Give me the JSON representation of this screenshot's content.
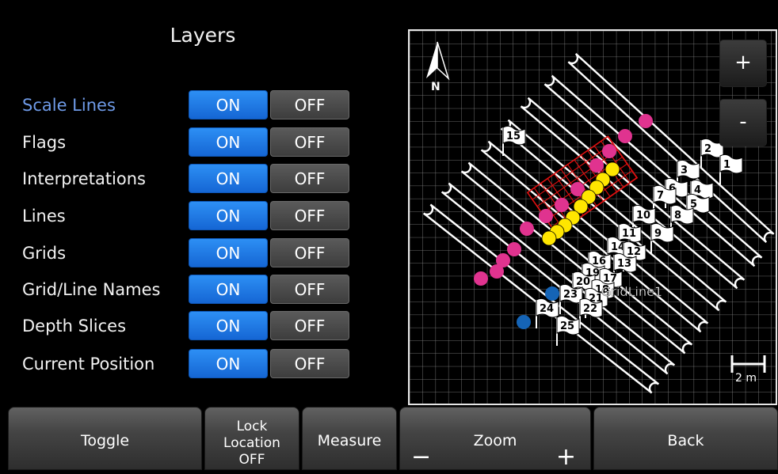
{
  "panel": {
    "title": "Layers",
    "layers": [
      {
        "label": "Scale Lines",
        "on": "ON",
        "off": "OFF"
      },
      {
        "label": "Flags",
        "on": "ON",
        "off": "OFF"
      },
      {
        "label": "Interpretations",
        "on": "ON",
        "off": "OFF"
      },
      {
        "label": "Lines",
        "on": "ON",
        "off": "OFF"
      },
      {
        "label": "Grids",
        "on": "ON",
        "off": "OFF"
      },
      {
        "label": "Grid/Line Names",
        "on": "ON",
        "off": "OFF"
      },
      {
        "label": "Depth Slices",
        "on": "ON",
        "off": "OFF"
      },
      {
        "label": "Current Position",
        "on": "ON",
        "off": "OFF"
      }
    ]
  },
  "map": {
    "north_label": "N",
    "zoom_in": "+",
    "zoom_out": "-",
    "scale_label": "2 m",
    "grid_line_label": "GridLine1",
    "flags": [
      "15",
      "2",
      "1",
      "3",
      "6",
      "4",
      "7",
      "5",
      "8",
      "10",
      "9",
      "11",
      "14",
      "12",
      "16",
      "13",
      "19",
      "17",
      "20",
      "18",
      "23",
      "21",
      "22",
      "24",
      "25"
    ],
    "colors": {
      "flag_magenta": "#e0338f",
      "flag_yellow": "#ffe600",
      "interpretation_red": "#e01010",
      "position_blue": "#1564b6"
    }
  },
  "bottom": {
    "toggle": "Toggle",
    "lock_line1": "Lock",
    "lock_line2": "Location",
    "lock_line3": "OFF",
    "measure": "Measure",
    "zoom": "Zoom",
    "zoom_minus": "−",
    "zoom_plus": "+",
    "back": "Back"
  },
  "colors": {
    "on_button": "#1f7be6",
    "off_button": "#4a4a4a",
    "active_label": "#6f9be8"
  }
}
